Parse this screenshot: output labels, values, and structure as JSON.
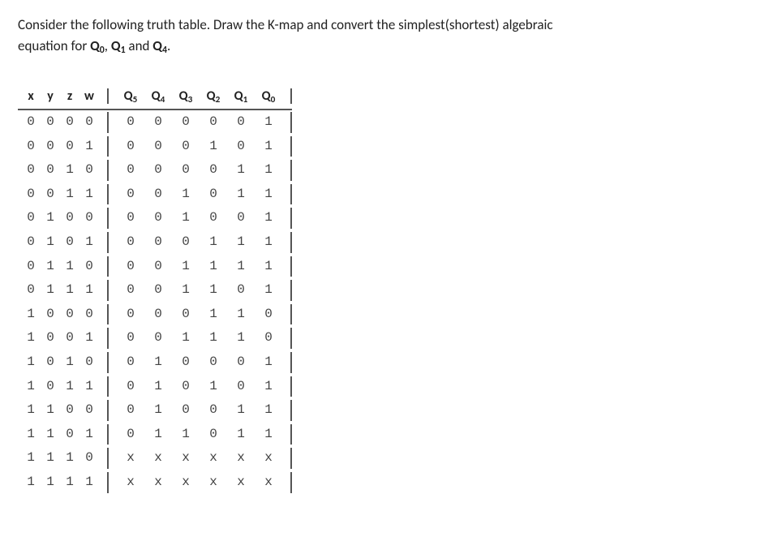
{
  "instruction_line1": "Consider the following truth table. Draw the K-map and convert the simplest(shortest) algebraic",
  "instruction_line2_prefix": "equation for ",
  "instruction_q0": "Q",
  "instruction_q0_sub": "0",
  "instruction_sep1": ", ",
  "instruction_q1": "Q",
  "instruction_q1_sub": "1",
  "instruction_sep2": " and ",
  "instruction_q4": "Q",
  "instruction_q4_sub": "4",
  "instruction_end": ".",
  "header": {
    "inputs": [
      "x",
      "y",
      "z",
      "w"
    ],
    "outputs": [
      {
        "sym": "Q",
        "sub": "5"
      },
      {
        "sym": "Q",
        "sub": "4"
      },
      {
        "sym": "Q",
        "sub": "3"
      },
      {
        "sym": "Q",
        "sub": "2"
      },
      {
        "sym": "Q",
        "sub": "1"
      },
      {
        "sym": "Q",
        "sub": "0"
      }
    ]
  },
  "rows": [
    {
      "in": [
        "0",
        "0",
        "0",
        "0"
      ],
      "out": [
        "0",
        "0",
        "0",
        "0",
        "0",
        "1"
      ]
    },
    {
      "in": [
        "0",
        "0",
        "0",
        "1"
      ],
      "out": [
        "0",
        "0",
        "0",
        "1",
        "0",
        "1"
      ]
    },
    {
      "in": [
        "0",
        "0",
        "1",
        "0"
      ],
      "out": [
        "0",
        "0",
        "0",
        "0",
        "1",
        "1"
      ]
    },
    {
      "in": [
        "0",
        "0",
        "1",
        "1"
      ],
      "out": [
        "0",
        "0",
        "1",
        "0",
        "1",
        "1"
      ]
    },
    {
      "in": [
        "0",
        "1",
        "0",
        "0"
      ],
      "out": [
        "0",
        "0",
        "1",
        "0",
        "0",
        "1"
      ]
    },
    {
      "in": [
        "0",
        "1",
        "0",
        "1"
      ],
      "out": [
        "0",
        "0",
        "0",
        "1",
        "1",
        "1"
      ]
    },
    {
      "in": [
        "0",
        "1",
        "1",
        "0"
      ],
      "out": [
        "0",
        "0",
        "1",
        "1",
        "1",
        "1"
      ]
    },
    {
      "in": [
        "0",
        "1",
        "1",
        "1"
      ],
      "out": [
        "0",
        "0",
        "1",
        "1",
        "0",
        "1"
      ]
    },
    {
      "in": [
        "1",
        "0",
        "0",
        "0"
      ],
      "out": [
        "0",
        "0",
        "0",
        "1",
        "1",
        "0"
      ]
    },
    {
      "in": [
        "1",
        "0",
        "0",
        "1"
      ],
      "out": [
        "0",
        "0",
        "1",
        "1",
        "1",
        "0"
      ]
    },
    {
      "in": [
        "1",
        "0",
        "1",
        "0"
      ],
      "out": [
        "0",
        "1",
        "0",
        "0",
        "0",
        "1"
      ]
    },
    {
      "in": [
        "1",
        "0",
        "1",
        "1"
      ],
      "out": [
        "0",
        "1",
        "0",
        "1",
        "0",
        "1"
      ]
    },
    {
      "in": [
        "1",
        "1",
        "0",
        "0"
      ],
      "out": [
        "0",
        "1",
        "0",
        "0",
        "1",
        "1"
      ]
    },
    {
      "in": [
        "1",
        "1",
        "0",
        "1"
      ],
      "out": [
        "0",
        "1",
        "1",
        "0",
        "1",
        "1"
      ]
    },
    {
      "in": [
        "1",
        "1",
        "1",
        "0"
      ],
      "out": [
        "x",
        "x",
        "x",
        "x",
        "x",
        "x"
      ]
    },
    {
      "in": [
        "1",
        "1",
        "1",
        "1"
      ],
      "out": [
        "x",
        "x",
        "x",
        "x",
        "x",
        "x"
      ]
    }
  ]
}
